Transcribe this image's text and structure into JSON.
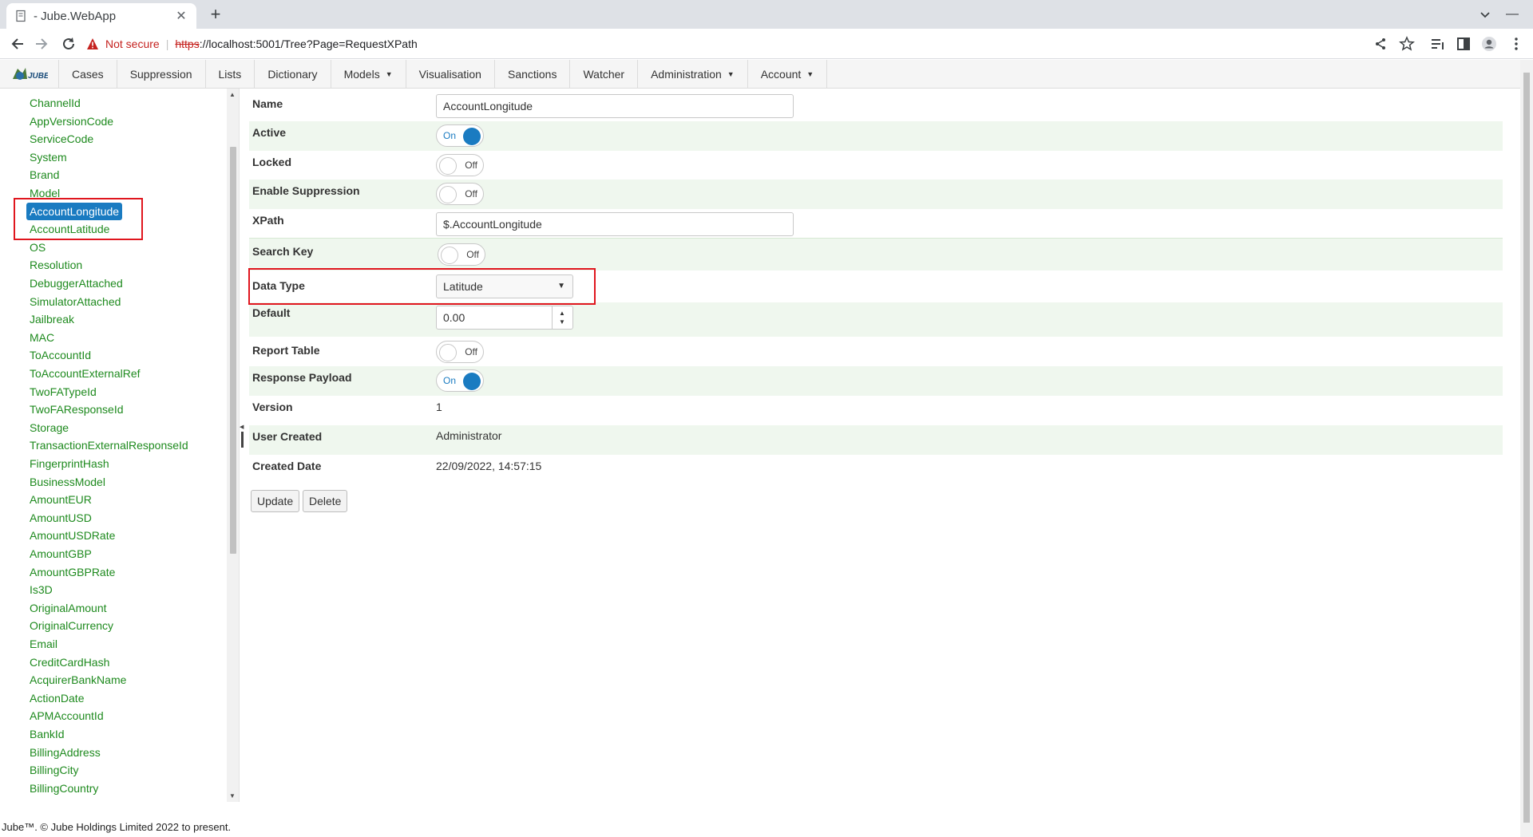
{
  "browser": {
    "tab_title": "- Jube.WebApp",
    "not_secure": "Not secure",
    "url_scheme": "https",
    "url_rest": "://localhost:5001/Tree?Page=RequestXPath"
  },
  "menu": {
    "items": [
      {
        "label": "Cases",
        "caret": false
      },
      {
        "label": "Suppression",
        "caret": false
      },
      {
        "label": "Lists",
        "caret": false
      },
      {
        "label": "Dictionary",
        "caret": false
      },
      {
        "label": "Models",
        "caret": true
      },
      {
        "label": "Visualisation",
        "caret": false
      },
      {
        "label": "Sanctions",
        "caret": false
      },
      {
        "label": "Watcher",
        "caret": false
      },
      {
        "label": "Administration",
        "caret": true
      },
      {
        "label": "Account",
        "caret": true
      }
    ]
  },
  "tree": {
    "selected_index": 5,
    "items": [
      "ChannelId",
      "AppVersionCode",
      "ServiceCode",
      "System",
      "Brand",
      "Model",
      "AccountLongitude",
      "AccountLatitude",
      "OS",
      "Resolution",
      "DebuggerAttached",
      "SimulatorAttached",
      "Jailbreak",
      "MAC",
      "ToAccountId",
      "ToAccountExternalRef",
      "TwoFATypeId",
      "TwoFAResponseId",
      "Storage",
      "TransactionExternalResponseId",
      "FingerprintHash",
      "BusinessModel",
      "AmountEUR",
      "AmountUSD",
      "AmountUSDRate",
      "AmountGBP",
      "AmountGBPRate",
      "Is3D",
      "OriginalAmount",
      "OriginalCurrency",
      "Email",
      "CreditCardHash",
      "AcquirerBankName",
      "ActionDate",
      "APMAccountId",
      "BankId",
      "BillingAddress",
      "BillingCity",
      "BillingCountry"
    ]
  },
  "form": {
    "name_label": "Name",
    "name_value": "AccountLongitude",
    "active_label": "Active",
    "active_state": "On",
    "locked_label": "Locked",
    "locked_state": "Off",
    "suppression_label": "Enable Suppression",
    "suppression_state": "Off",
    "xpath_label": "XPath",
    "xpath_value": "$.AccountLongitude",
    "searchkey_label": "Search Key",
    "searchkey_state": "Off",
    "datatype_label": "Data Type",
    "datatype_value": "Latitude",
    "default_label": "Default",
    "default_value": "0.00",
    "reporttable_label": "Report Table",
    "reporttable_state": "Off",
    "responsepayload_label": "Response Payload",
    "responsepayload_state": "On",
    "version_label": "Version",
    "version_value": "1",
    "usercreated_label": "User Created",
    "usercreated_value": "Administrator",
    "createddate_label": "Created Date",
    "createddate_value": "22/09/2022, 14:57:15",
    "update_label": "Update",
    "delete_label": "Delete"
  },
  "footer": {
    "text": "Jube™. © Jube Holdings Limited 2022 to present."
  },
  "colors": {
    "tree_link": "#1e8a1e",
    "selected": "#1a7bc1",
    "row_alt": "#eff7ee",
    "highlight": "#e0161e"
  }
}
